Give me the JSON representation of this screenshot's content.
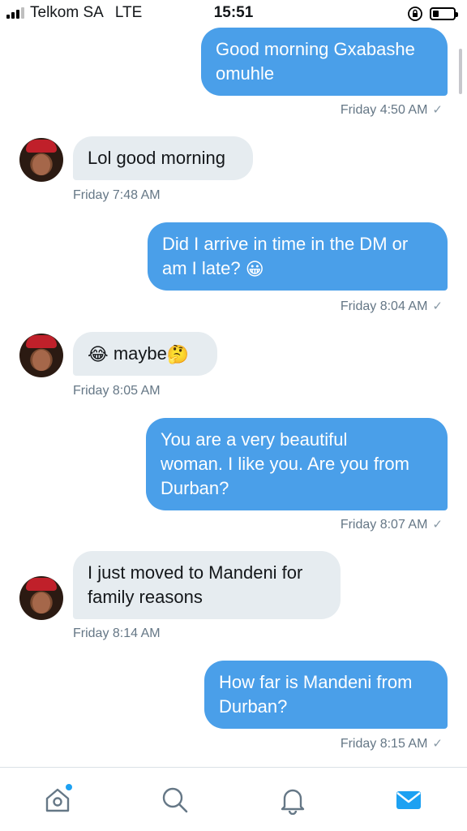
{
  "status_bar": {
    "carrier": "Telkom SA",
    "network": "LTE",
    "time": "15:51",
    "battery_level": 0.25
  },
  "conversation": [
    {
      "direction": "out",
      "lines": [
        "Good morning Gxabashe",
        "omuhle"
      ],
      "timestamp": "Friday 4:50 AM"
    },
    {
      "direction": "in",
      "lines": [
        "Lol good morning"
      ],
      "timestamp": "Friday 7:48 AM"
    },
    {
      "direction": "out",
      "lines": [
        "Did I arrive in time in the DM or",
        "am I late?"
      ],
      "emoji": "😀",
      "timestamp": "Friday 8:04 AM"
    },
    {
      "direction": "in",
      "lines": [
        "maybe"
      ],
      "emoji_before": "😂",
      "emoji_after": "🤔",
      "timestamp": "Friday 8:05 AM"
    },
    {
      "direction": "out",
      "lines": [
        "You are a very beautiful",
        "woman. I like you. Are you from",
        "Durban?"
      ],
      "timestamp": "Friday 8:07 AM"
    },
    {
      "direction": "in",
      "lines": [
        "I just moved to Mandeni for",
        "family reasons"
      ],
      "timestamp": "Friday 8:14 AM"
    },
    {
      "direction": "out",
      "lines": [
        "How far is Mandeni from",
        "Durban?"
      ],
      "timestamp": "Friday 8:15 AM"
    }
  ],
  "read_check": "✓",
  "tab_bar": {
    "tabs": [
      {
        "icon": "home-icon",
        "has_notification": true
      },
      {
        "icon": "search-icon"
      },
      {
        "icon": "bell-icon"
      },
      {
        "icon": "mail-icon",
        "active": true
      }
    ],
    "active_color": "#1da1f2",
    "inactive_color": "#657786"
  },
  "colors": {
    "outgoing_bubble": "#4a9fe9",
    "incoming_bubble": "#e6ecf0"
  }
}
